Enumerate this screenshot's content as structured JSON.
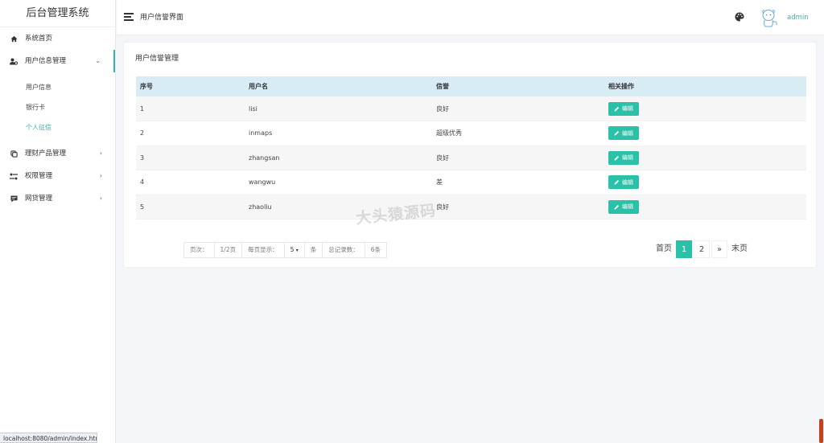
{
  "app_title": "后台管理系统",
  "sidebar": {
    "items": [
      {
        "label": "系统首页",
        "icon": "home-icon"
      },
      {
        "label": "用户信息管理",
        "icon": "users-icon",
        "arrow": "⌄"
      },
      {
        "label": "理财产品管理",
        "icon": "copy-icon",
        "arrow": "›"
      },
      {
        "label": "权限管理",
        "icon": "key-icon",
        "arrow": "›"
      },
      {
        "label": "网贷管理",
        "icon": "message-icon",
        "arrow": "›"
      }
    ],
    "sub_items": [
      {
        "label": "用户信息"
      },
      {
        "label": "银行卡"
      },
      {
        "label": "个人征信"
      }
    ]
  },
  "status_url": "localhost:8080/admin/index.html",
  "header": {
    "title": "用户信誉界面",
    "username": "admin"
  },
  "panel": {
    "title": "用户信誉管理",
    "columns": [
      "序号",
      "用户名",
      "信誉",
      "相关操作"
    ],
    "rows": [
      {
        "id": "1",
        "username": "lisi",
        "credit": "良好",
        "action": "编辑"
      },
      {
        "id": "2",
        "username": "inmaps",
        "credit": "超级优秀",
        "action": "编辑"
      },
      {
        "id": "3",
        "username": "zhangsan",
        "credit": "良好",
        "action": "编辑"
      },
      {
        "id": "4",
        "username": "wangwu",
        "credit": "差",
        "action": "编辑"
      },
      {
        "id": "5",
        "username": "zhaoliu",
        "credit": "良好",
        "action": "编辑"
      }
    ]
  },
  "pager_info": {
    "page_label": "页次：",
    "page_value": "1/2页",
    "per_page_label": "每页显示：",
    "per_page_value": "5",
    "per_page_unit": "条",
    "total_label": "总记录数：",
    "total_value": "6条"
  },
  "pagination": {
    "first": "首页",
    "pages": [
      "1",
      "2"
    ],
    "next": "»",
    "last": "末页"
  },
  "watermark": "大头猿源码",
  "colors": {
    "accent": "#2bc0a8",
    "table_header": "#d8ecf6"
  }
}
